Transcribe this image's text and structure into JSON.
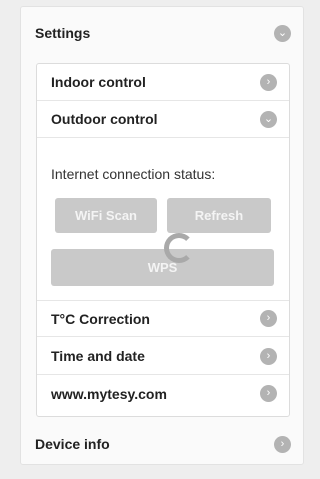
{
  "settings": {
    "title": "Settings",
    "items": {
      "indoor": "Indoor control",
      "outdoor": "Outdoor control",
      "tcorr": "T°C Correction",
      "time": "Time and date",
      "web": "www.mytesy.com"
    },
    "outdoor_panel": {
      "status_label": "Internet connection status:",
      "wifi_scan": "WiFi Scan",
      "refresh": "Refresh",
      "wps": "WPS"
    }
  },
  "device_info": "Device info",
  "icons": {
    "expanded": "chevron-down-icon",
    "collapsed": "chevron-right-icon"
  },
  "colors": {
    "chevron": "#b3b3b3",
    "button": "#c9c9c9"
  }
}
